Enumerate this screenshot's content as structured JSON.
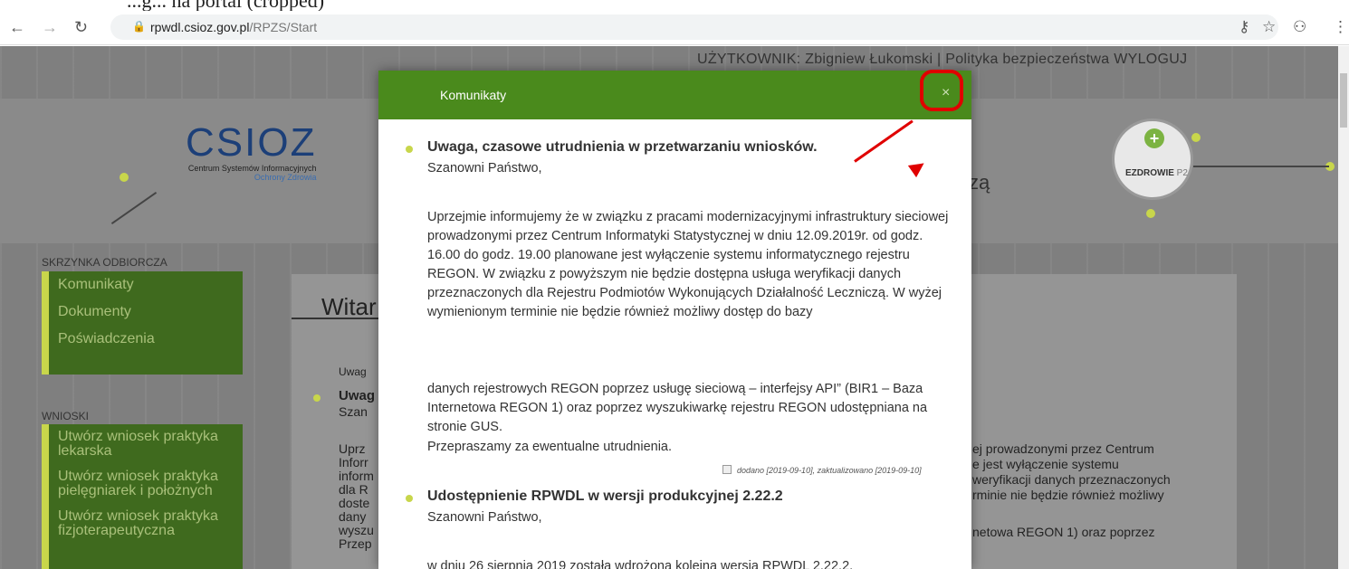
{
  "top_text": "...g... na portal (cropped)",
  "browser": {
    "back_icon": "back-arrow-icon",
    "forward_icon": "forward-arrow-icon",
    "reload_icon": "reload-icon",
    "url_host": "rpwdl.csioz.gov.pl",
    "url_path": "/RPZS/Start"
  },
  "header": {
    "user": "UŻYTKOWNIK: Zbigniew Łukomski | Polityka bezpieczeństwa WYLOGUJ",
    "logo": "CSIOZ",
    "logo_sub": "Centrum Systemów Informacyjnych",
    "logo_sub2": "Ochrony Zdrowia",
    "ezdrowie": "EZDROWIE",
    "ezdrowie_p2": "P2",
    "tagline_fragment": "zą"
  },
  "sidebar": {
    "inbox_label": "SKRZYNKA ODBIORCZA",
    "inbox_items": [
      "Komunikaty",
      "Dokumenty",
      "Poświadczenia"
    ],
    "requests_label": "WNIOSKI",
    "request_items": [
      "Utwórz wniosek praktyka lekarska",
      "Utwórz wniosek praktyka pielęgniarek i położnych",
      "Utwórz wniosek praktyka fizjoterapeutyczna"
    ]
  },
  "content": {
    "welcome": "Witar",
    "bg_uwag": "Uwag",
    "bg_uwag2": "Uwag",
    "bg_szan": "Szan",
    "bg_lines": [
      "Uprz",
      "Inforr",
      "inform",
      "dla R",
      "doste",
      "dany",
      "wyszu",
      "Przep"
    ],
    "bg_right_lines": [
      "ej prowadzonymi przez Centrum",
      "e jest wyłączenie systemu",
      "weryfikacji danych przeznaczonych",
      "rminie nie będzie również możliwy",
      "netowa REGON 1) oraz poprzez"
    ]
  },
  "modal": {
    "title": "Komunikaty",
    "close": "×",
    "msg1_title": "Uwaga, czasowe utrudnienia w przetwarzaniu wniosków.",
    "msg1_greeting": "Szanowni Państwo,",
    "msg1_body": "Uprzejmie informujemy że w związku z pracami modernizacyjnymi infrastruktury sieciowej prowadzonymi przez Centrum Informatyki Statystycznej w dniu 12.09.2019r. od godz. 16.00 do godz. 19.00 planowane jest wyłączenie systemu informatycznego rejestru REGON. W związku z powyższym nie będzie dostępna usługa weryfikacji danych przeznaczonych dla Rejestru Podmiotów Wykonujących Działalność Leczniczą. W wyżej wymienionym terminie nie będzie również możliwy dostęp do bazy",
    "msg1_body2": "danych rejestrowych REGON poprzez usługę sieciową – interfejsy API” (BIR1 – Baza Internetowa REGON 1) oraz poprzez wyszukiwarkę rejestru REGON udostępniana na stronie GUS.",
    "msg1_apology": "Przepraszamy za ewentualne utrudnienia.",
    "msg1_stamp": "dodano [2019-09-10], zaktualizowano [2019-09-10]",
    "msg2_title": "Udostępnienie RPWDL w wersji produkcyjnej 2.22.2",
    "msg2_greeting": "Szanowni Państwo,",
    "msg2_body": "w dniu 26 sierpnia 2019 została wdrożona kolejna wersja RPWDL 2.22.2,"
  }
}
